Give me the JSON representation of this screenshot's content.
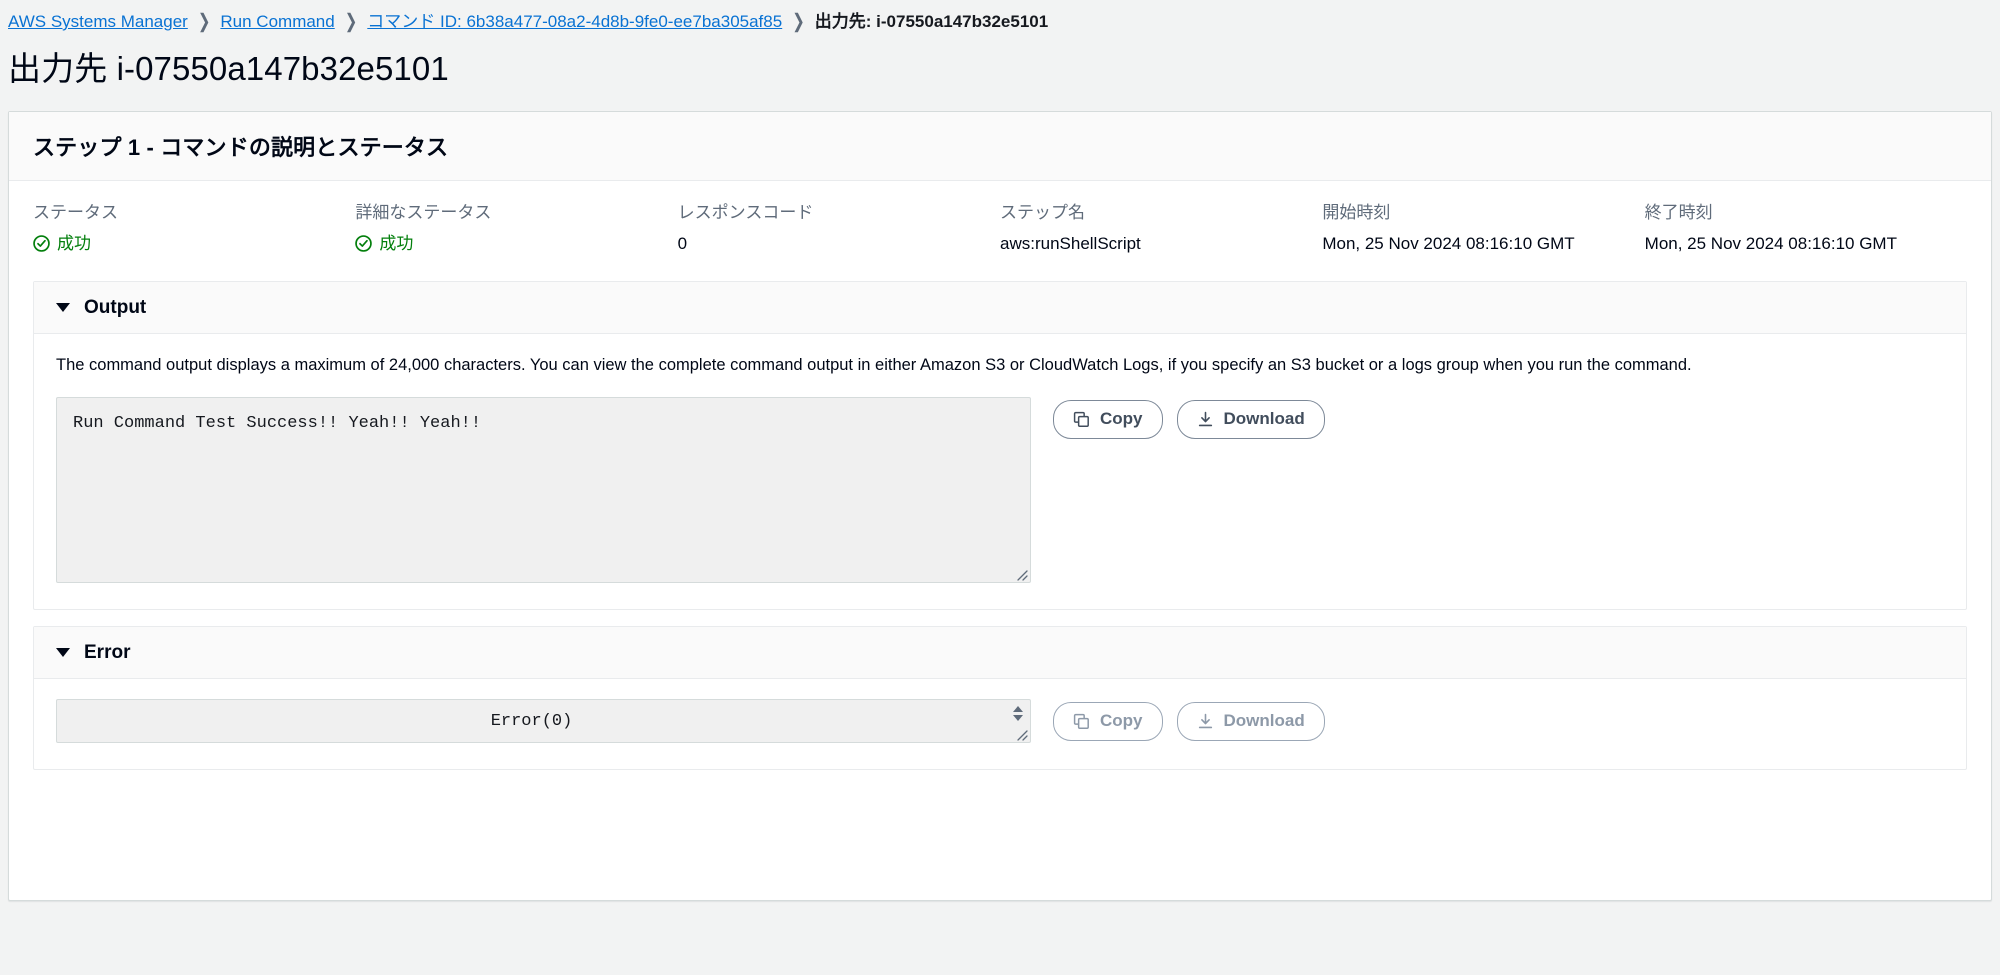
{
  "breadcrumb": {
    "items": [
      {
        "label": "AWS Systems Manager",
        "type": "link"
      },
      {
        "label": "Run Command",
        "type": "link"
      },
      {
        "label": "コマンド ID: 6b38a477-08a2-4d8b-9fe0-ee7ba305af85",
        "type": "link"
      },
      {
        "label": "出力先: i-07550a147b32e5101",
        "type": "current"
      }
    ],
    "separator": "❯"
  },
  "page": {
    "title": "出力先 i-07550a147b32e5101"
  },
  "step_container": {
    "heading": "ステップ 1 - コマンドの説明とステータス",
    "fields": [
      {
        "label": "ステータス",
        "value": "成功",
        "icon": "success-check-icon",
        "state": "success"
      },
      {
        "label": "詳細なステータス",
        "value": "成功",
        "icon": "success-check-icon",
        "state": "success"
      },
      {
        "label": "レスポンスコード",
        "value": "0",
        "icon": null,
        "state": "plain"
      },
      {
        "label": "ステップ名",
        "value": "aws:runShellScript",
        "icon": null,
        "state": "plain"
      },
      {
        "label": "開始時刻",
        "value": "Mon, 25 Nov 2024 08:16:10 GMT",
        "icon": null,
        "state": "plain"
      },
      {
        "label": "終了時刻",
        "value": "Mon, 25 Nov 2024 08:16:10 GMT",
        "icon": null,
        "state": "plain"
      }
    ]
  },
  "output_section": {
    "title": "Output",
    "expanded": true,
    "hint": "The command output displays a maximum of 24,000 characters. You can view the complete command output in either Amazon S3 or CloudWatch Logs, if you specify an S3 bucket or a logs group when you run the command.",
    "content": "Run Command Test Success!! Yeah!! Yeah!!",
    "copy_label": "Copy",
    "download_label": "Download"
  },
  "error_section": {
    "title": "Error",
    "expanded": true,
    "content": "Error(0)",
    "copy_label": "Copy",
    "download_label": "Download"
  },
  "colors": {
    "link": "#0972d3",
    "success": "#037f0c",
    "text": "#000716",
    "muted_text": "#5f6b7a",
    "page_bg": "#f2f3f3",
    "card_bg": "#ffffff",
    "field_bg": "#f0f0f0",
    "border": "#d5dbdb"
  }
}
